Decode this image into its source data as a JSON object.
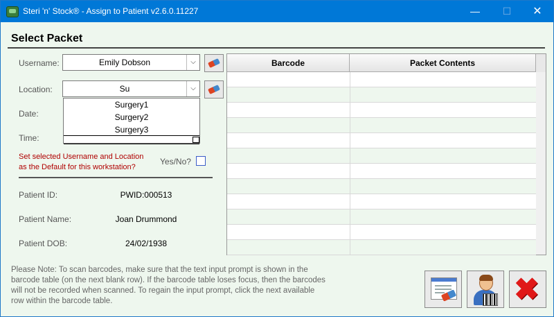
{
  "window": {
    "title": "Steri 'n' Stock® - Assign to Patient v2.6.0.11227",
    "minimize": "—",
    "maximize": "☐",
    "close": "✕"
  },
  "heading": "Select Packet",
  "form": {
    "username_label": "Username:",
    "username_value": "Emily Dobson",
    "location_label": "Location:",
    "location_value": "Su",
    "date_label": "Date:",
    "time_label": "Time:",
    "dropdown_options": [
      "Surgery1",
      "Surgery2",
      "Surgery3"
    ],
    "default_note_line1": "Set selected Username and Location",
    "default_note_line2": "as the Default for this workstation?",
    "yesno_label": "Yes/No?",
    "yesno_checked": false
  },
  "patient": {
    "id_label": "Patient ID:",
    "id_value": "PWID:000513",
    "name_label": "Patient Name:",
    "name_value": "Joan Drummond",
    "dob_label": "Patient DOB:",
    "dob_value": "24/02/1938"
  },
  "table": {
    "columns": [
      "Barcode",
      "Packet Contents"
    ],
    "rows": [
      [
        "",
        ""
      ],
      [
        "",
        ""
      ],
      [
        "",
        ""
      ],
      [
        "",
        ""
      ],
      [
        "",
        ""
      ],
      [
        "",
        ""
      ],
      [
        "",
        ""
      ],
      [
        "",
        ""
      ],
      [
        "",
        ""
      ],
      [
        "",
        ""
      ],
      [
        "",
        ""
      ],
      [
        "",
        ""
      ]
    ]
  },
  "note": "Please Note: To scan barcodes, make sure that the text input prompt is shown in the barcode table (on the next blank row). If the barcode table loses focus, then the barcodes will not be recorded when scanned. To regain the input prompt, click the next available row within the barcode table.",
  "icons": {
    "app": "app-icon",
    "clear": "eraser-icon",
    "clear_form": "document-eraser-icon",
    "assign": "patient-barcode-icon",
    "cancel": "red-x-icon"
  },
  "colors": {
    "titlebar": "#0078d7",
    "background": "#eef7ee",
    "warning_text": "#b00000",
    "cancel": "#e01818"
  }
}
